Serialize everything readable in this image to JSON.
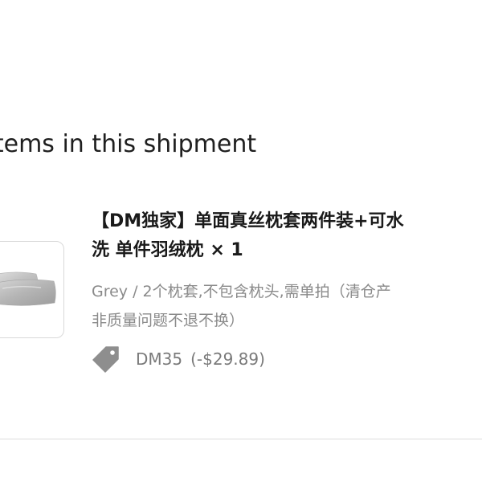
{
  "shipment": {
    "section_title": "Items in this shipment"
  },
  "item": {
    "image_alt": "Grey silk pillowcase",
    "title_line1": "【DM独家】单面真丝枕套两件装+可水",
    "title_line2": "洗 单件羽绒枕 × 1",
    "variant_line1": "Grey / 2个枕套,不包含枕头,需单拍（清仓产",
    "variant_line2": "非质量问题不退不换）",
    "discount_code": "DM35",
    "discount_amount": "(-$29.89)",
    "discount_icon": "tag-icon"
  }
}
